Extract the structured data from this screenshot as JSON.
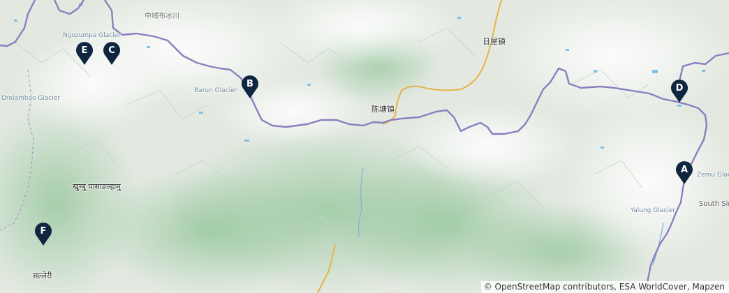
{
  "map": {
    "places": [
      {
        "id": "ngozumpa",
        "label": "Ngozumpa Glacier",
        "kind": "glacier"
      },
      {
        "id": "zhongrongbu",
        "label": "中绒布冰川",
        "kind": "glacier"
      },
      {
        "id": "riwu",
        "label": "日屋镇",
        "kind": "town"
      },
      {
        "id": "barun",
        "label": "Barun Glacier",
        "kind": "glacier"
      },
      {
        "id": "drolambao",
        "label": "Drolambao Glacier",
        "kind": "glacier"
      },
      {
        "id": "chentang",
        "label": "陈塘镇",
        "kind": "town"
      },
      {
        "id": "khumbu",
        "label": "खुम्बु पासाङल्हामु",
        "kind": "area"
      },
      {
        "id": "zemu",
        "label": "Zemu Glac",
        "kind": "glacier"
      },
      {
        "id": "yalung",
        "label": "Yalung Glacier",
        "kind": "glacier"
      },
      {
        "id": "southsim",
        "label": "South Sim",
        "kind": "area"
      },
      {
        "id": "salleri",
        "label": "सल्लेरी",
        "kind": "town"
      }
    ],
    "markers": [
      {
        "id": "A",
        "label": "A"
      },
      {
        "id": "B",
        "label": "B"
      },
      {
        "id": "C",
        "label": "C"
      },
      {
        "id": "D",
        "label": "D"
      },
      {
        "id": "E",
        "label": "E"
      },
      {
        "id": "F",
        "label": "F"
      }
    ],
    "colors": {
      "marker": "#0f2540",
      "border": "#8a7fbf",
      "road": "#e8b24a",
      "river": "#7fb4d8",
      "terrain": "#e6ece4",
      "forest": "#9cc9a0"
    }
  },
  "attribution": "© OpenStreetMap contributors, ESA WorldCover, Mapzen"
}
